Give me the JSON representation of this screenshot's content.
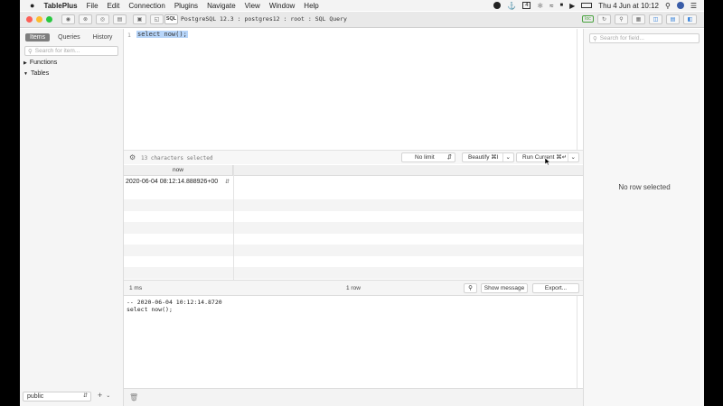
{
  "menubar": {
    "apple": "",
    "items": [
      "TablePlus",
      "File",
      "Edit",
      "Connection",
      "Plugins",
      "Navigate",
      "View",
      "Window",
      "Help"
    ],
    "clock": "Thu 4 Jun at  10:12",
    "tray_number": "4"
  },
  "toolbar": {
    "sql_badge": "SQL",
    "connection": "PostgreSQL 12.3 : postgres12 : root : SQL Query",
    "env_badge": "loc"
  },
  "sidebar": {
    "tabs": [
      {
        "label": "Items",
        "active": true
      },
      {
        "label": "Queries",
        "active": false
      },
      {
        "label": "History",
        "active": false
      }
    ],
    "search_placeholder": "Search for item...",
    "tree": [
      {
        "label": "Functions",
        "arrow": "▶"
      },
      {
        "label": "Tables",
        "arrow": "▼"
      }
    ],
    "schema": "public",
    "add_label": "+"
  },
  "editor": {
    "line_number": "1",
    "code": "select now();",
    "selection_info": "13 characters selected",
    "limit_label": "No limit",
    "beautify_label": "Beautify ⌘I",
    "run_label": "Run Current ⌘↵"
  },
  "results": {
    "columns": [
      "now"
    ],
    "rows": [
      [
        "2020-06-04 08:12:14.888926+00"
      ]
    ],
    "time": "1 ms",
    "row_count": "1 row",
    "show_message_label": "Show message",
    "export_label": "Export..."
  },
  "log": {
    "lines": [
      "-- 2020-06-04 10:12:14.8720",
      "select now();"
    ]
  },
  "right_pane": {
    "search_placeholder": "Search for field...",
    "empty_text": "No row selected"
  },
  "colors": {
    "selection": "#b7d5f9",
    "light_red": "#fc5f57",
    "light_yellow": "#fdbc2e",
    "light_green": "#28c840",
    "active_tab": "#7e7e7e"
  }
}
